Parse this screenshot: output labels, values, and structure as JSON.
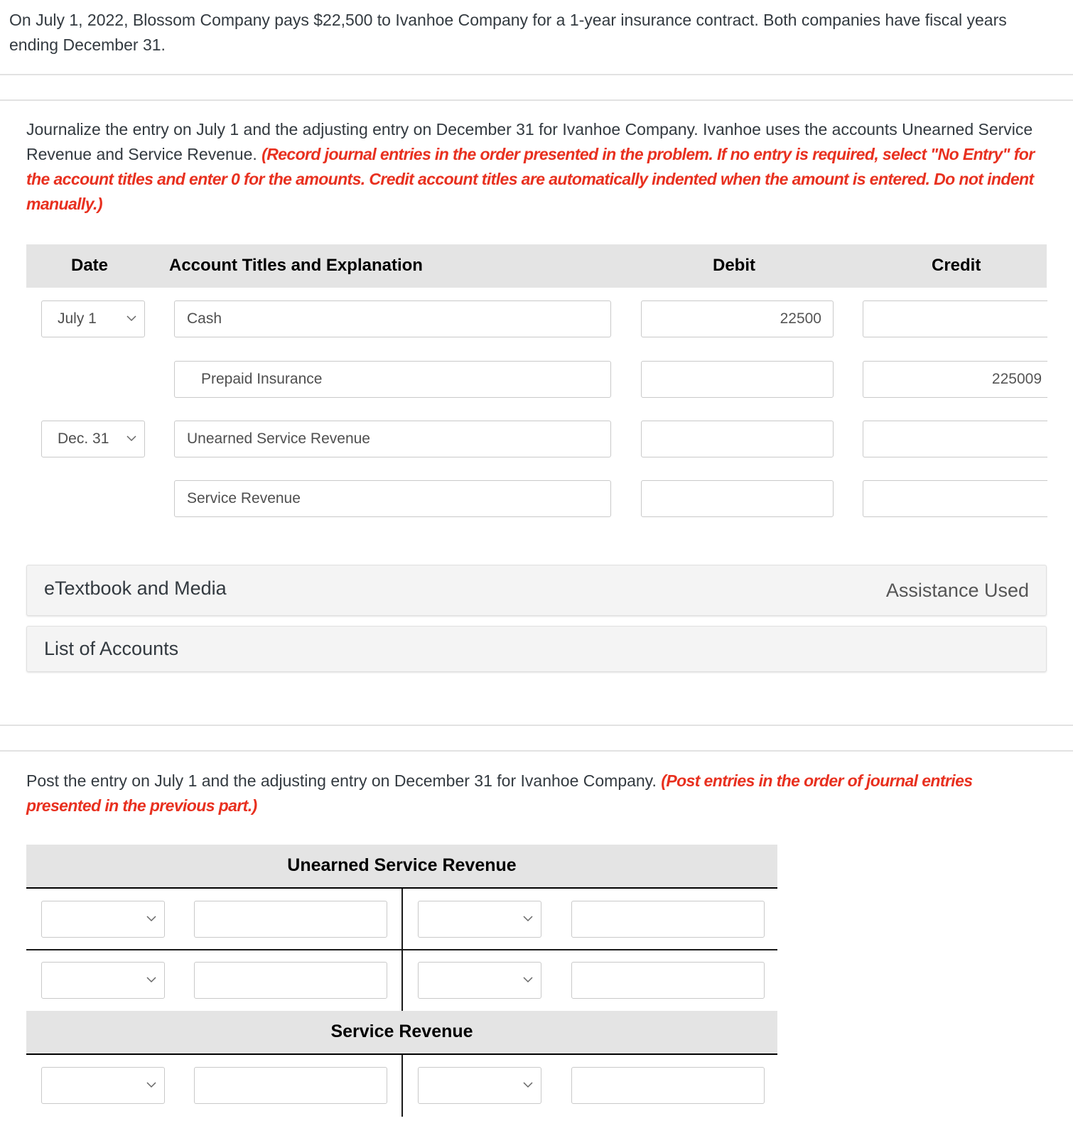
{
  "problem": {
    "intro": "On July 1, 2022, Blossom Company pays $22,500 to Ivanhoe Company for a 1-year insurance contract. Both companies have fiscal years ending December 31."
  },
  "part1": {
    "instruction": "Journalize the entry on July 1 and the adjusting entry on December 31 for Ivanhoe Company. Ivanhoe uses the accounts Unearned Service Revenue and Service Revenue. ",
    "instruction_note": "(Record journal entries in the order presented in the problem. If no entry is required, select \"No Entry\" for the account titles and enter 0 for the amounts. Credit account titles are automatically indented when the amount is entered. Do not indent manually.)",
    "headers": {
      "date": "Date",
      "account": "Account Titles and Explanation",
      "debit": "Debit",
      "credit": "Credit"
    },
    "rows": [
      {
        "date": "July 1",
        "account": "Cash",
        "debit": "22500",
        "credit": ""
      },
      {
        "date": "",
        "account": "Prepaid Insurance",
        "debit": "",
        "credit": "225009"
      },
      {
        "date": "Dec. 31",
        "account": "Unearned Service Revenue",
        "debit": "",
        "credit": ""
      },
      {
        "date": "",
        "account": "Service Revenue",
        "debit": "",
        "credit": ""
      }
    ],
    "etextbook_label": "eTextbook and Media",
    "assistance_label": "Assistance Used",
    "list_of_accounts_label": "List of Accounts"
  },
  "part2": {
    "instruction": "Post the entry on July 1 and the adjusting entry on December 31 for Ivanhoe Company. ",
    "instruction_note": "(Post entries in the order of journal entries presented in the previous part.)",
    "t_accounts": [
      {
        "title": "Unearned Service Revenue",
        "rows": [
          {
            "left_date": "",
            "left_amount": "",
            "right_date": "",
            "right_amount": ""
          },
          {
            "left_date": "",
            "left_amount": "",
            "right_date": "",
            "right_amount": ""
          }
        ]
      },
      {
        "title": "Service Revenue",
        "rows": [
          {
            "left_date": "",
            "left_amount": "",
            "right_date": "",
            "right_amount": ""
          }
        ]
      }
    ]
  },
  "colors": {
    "instruction_red": "#e8301f",
    "header_gray": "#e4e4e4",
    "panel_gray": "#f4f4f4"
  }
}
